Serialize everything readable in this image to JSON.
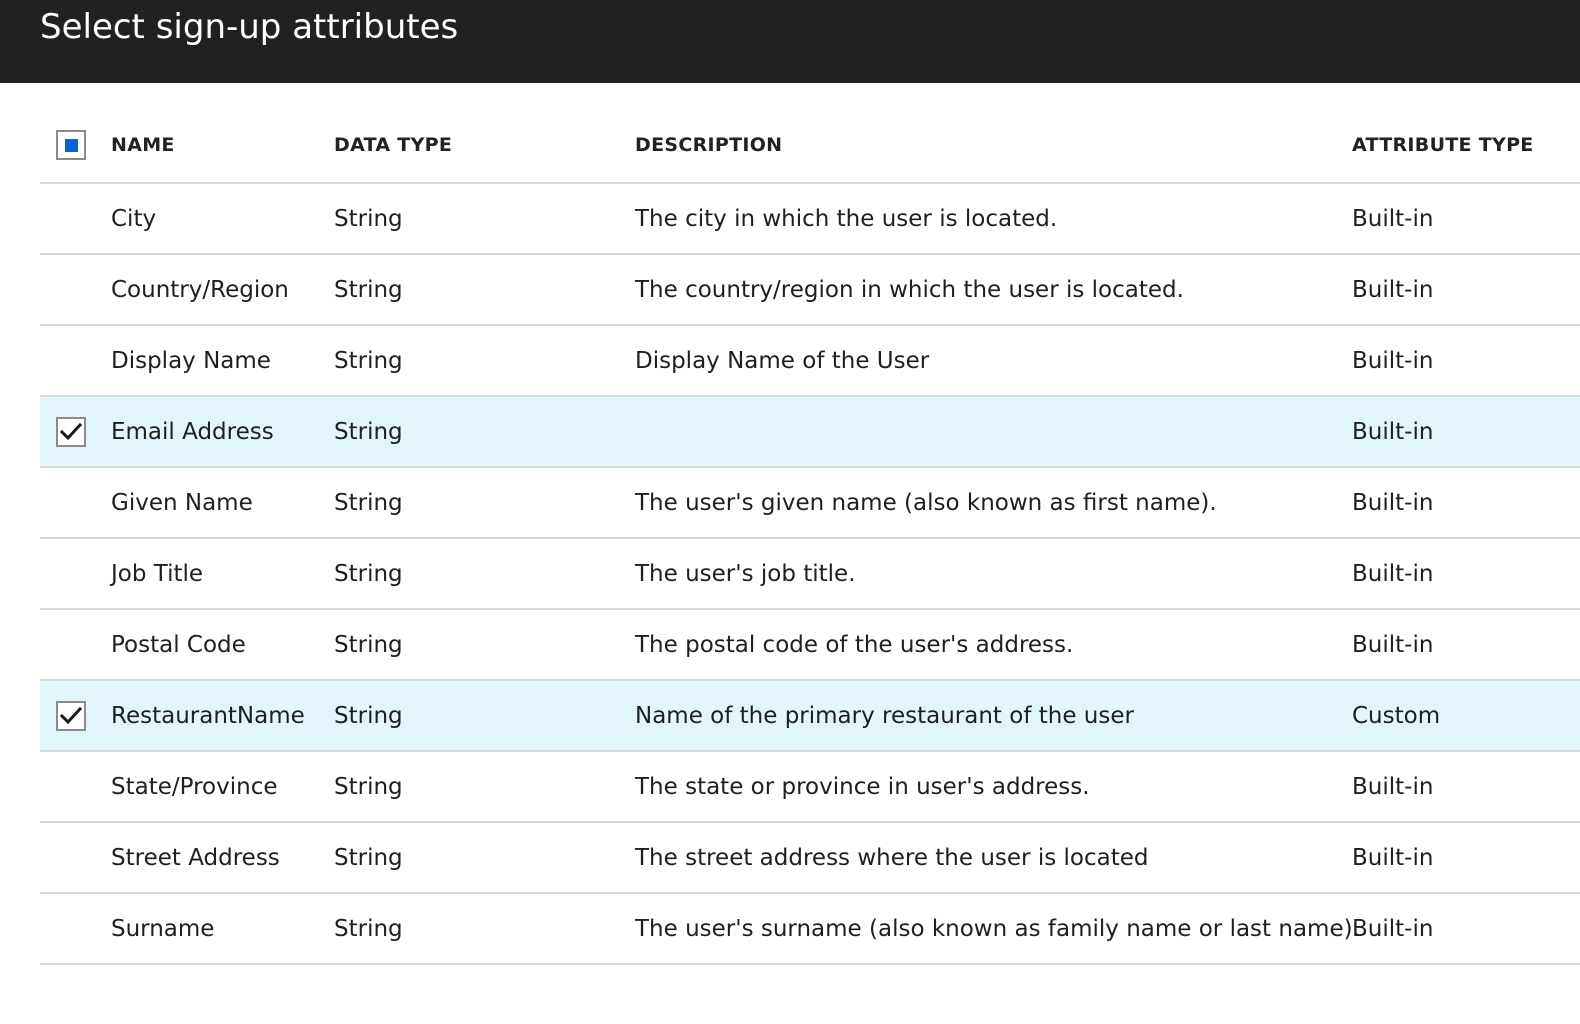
{
  "header": {
    "title": "Select sign-up attributes"
  },
  "table": {
    "columns": {
      "name": "NAME",
      "data_type": "DATA TYPE",
      "description": "DESCRIPTION",
      "attribute_type": "ATTRIBUTE TYPE"
    },
    "select_all_state": "partial",
    "rows": [
      {
        "checked": false,
        "name": "City",
        "data_type": "String",
        "description": "The city in which the user is located.",
        "attribute_type": "Built-in"
      },
      {
        "checked": false,
        "name": "Country/Region",
        "data_type": "String",
        "description": "The country/region in which the user is located.",
        "attribute_type": "Built-in"
      },
      {
        "checked": false,
        "name": "Display Name",
        "data_type": "String",
        "description": "Display Name of the User",
        "attribute_type": "Built-in"
      },
      {
        "checked": true,
        "name": "Email Address",
        "data_type": "String",
        "description": "",
        "attribute_type": "Built-in"
      },
      {
        "checked": false,
        "name": "Given Name",
        "data_type": "String",
        "description": "The user's given name (also known as first name).",
        "attribute_type": "Built-in"
      },
      {
        "checked": false,
        "name": "Job Title",
        "data_type": "String",
        "description": "The user's job title.",
        "attribute_type": "Built-in"
      },
      {
        "checked": false,
        "name": "Postal Code",
        "data_type": "String",
        "description": "The postal code of the user's address.",
        "attribute_type": "Built-in"
      },
      {
        "checked": true,
        "name": "RestaurantName",
        "data_type": "String",
        "description": "Name of the primary restaurant of the user",
        "attribute_type": "Custom"
      },
      {
        "checked": false,
        "name": "State/Province",
        "data_type": "String",
        "description": "The state or province in user's address.",
        "attribute_type": "Built-in"
      },
      {
        "checked": false,
        "name": "Street Address",
        "data_type": "String",
        "description": "The street address where the user is located",
        "attribute_type": "Built-in"
      },
      {
        "checked": false,
        "name": "Surname",
        "data_type": "String",
        "description": "The user's surname (also known as family name or last name).",
        "attribute_type": "Built-in"
      }
    ]
  },
  "colors": {
    "header_bg": "#212121",
    "selected_row_bg": "#e2f5fb",
    "accent": "#0b62d6",
    "divider": "#d9d9d9"
  },
  "icons": {
    "check": "checkmark-icon",
    "partial": "partial-select-icon"
  }
}
